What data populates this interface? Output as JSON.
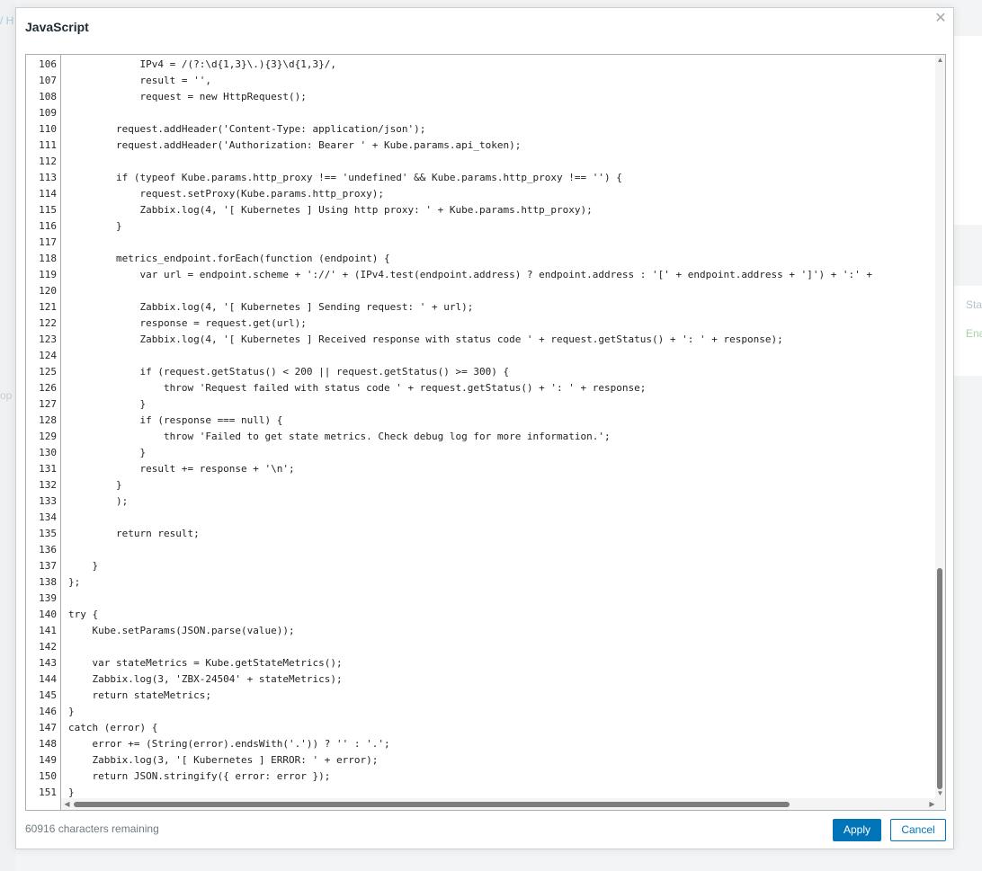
{
  "background": {
    "left_fragments": [
      "/ H",
      "op"
    ],
    "right_fragments": [
      "Sta",
      "Ena"
    ]
  },
  "modal": {
    "title": "JavaScript",
    "close_icon": "close-icon",
    "chars_remaining": "60916 characters remaining",
    "apply_label": "Apply",
    "cancel_label": "Cancel"
  },
  "editor": {
    "lines": [
      {
        "n": "106",
        "code": "            IPv4 = /(?:\\d{1,3}\\.){3}\\d{1,3}/,"
      },
      {
        "n": "107",
        "code": "            result = '',"
      },
      {
        "n": "108",
        "code": "            request = new HttpRequest();"
      },
      {
        "n": "109",
        "code": ""
      },
      {
        "n": "110",
        "code": "        request.addHeader('Content-Type: application/json');"
      },
      {
        "n": "111",
        "code": "        request.addHeader('Authorization: Bearer ' + Kube.params.api_token);"
      },
      {
        "n": "112",
        "code": ""
      },
      {
        "n": "113",
        "code": "        if (typeof Kube.params.http_proxy !== 'undefined' && Kube.params.http_proxy !== '') {"
      },
      {
        "n": "114",
        "code": "            request.setProxy(Kube.params.http_proxy);"
      },
      {
        "n": "115",
        "code": "            Zabbix.log(4, '[ Kubernetes ] Using http proxy: ' + Kube.params.http_proxy);"
      },
      {
        "n": "116",
        "code": "        }"
      },
      {
        "n": "117",
        "code": ""
      },
      {
        "n": "118",
        "code": "        metrics_endpoint.forEach(function (endpoint) {"
      },
      {
        "n": "119",
        "code": "            var url = endpoint.scheme + '://' + (IPv4.test(endpoint.address) ? endpoint.address : '[' + endpoint.address + ']') + ':' +"
      },
      {
        "n": "120",
        "code": ""
      },
      {
        "n": "121",
        "code": "            Zabbix.log(4, '[ Kubernetes ] Sending request: ' + url);"
      },
      {
        "n": "122",
        "code": "            response = request.get(url);"
      },
      {
        "n": "123",
        "code": "            Zabbix.log(4, '[ Kubernetes ] Received response with status code ' + request.getStatus() + ': ' + response);"
      },
      {
        "n": "124",
        "code": ""
      },
      {
        "n": "125",
        "code": "            if (request.getStatus() < 200 || request.getStatus() >= 300) {"
      },
      {
        "n": "126",
        "code": "                throw 'Request failed with status code ' + request.getStatus() + ': ' + response;"
      },
      {
        "n": "127",
        "code": "            }"
      },
      {
        "n": "128",
        "code": "            if (response === null) {"
      },
      {
        "n": "129",
        "code": "                throw 'Failed to get state metrics. Check debug log for more information.';"
      },
      {
        "n": "130",
        "code": "            }"
      },
      {
        "n": "131",
        "code": "            result += response + '\\n';"
      },
      {
        "n": "132",
        "code": "        }"
      },
      {
        "n": "133",
        "code": "        );"
      },
      {
        "n": "134",
        "code": ""
      },
      {
        "n": "135",
        "code": "        return result;"
      },
      {
        "n": "136",
        "code": ""
      },
      {
        "n": "137",
        "code": "    }"
      },
      {
        "n": "138",
        "code": "};"
      },
      {
        "n": "139",
        "code": ""
      },
      {
        "n": "140",
        "code": "try {"
      },
      {
        "n": "141",
        "code": "    Kube.setParams(JSON.parse(value));"
      },
      {
        "n": "142",
        "code": ""
      },
      {
        "n": "143",
        "code": "    var stateMetrics = Kube.getStateMetrics();"
      },
      {
        "n": "144",
        "code": "    Zabbix.log(3, 'ZBX-24504' + stateMetrics);"
      },
      {
        "n": "145",
        "code": "    return stateMetrics;"
      },
      {
        "n": "146",
        "code": "}"
      },
      {
        "n": "147",
        "code": "catch (error) {"
      },
      {
        "n": "148",
        "code": "    error += (String(error).endsWith('.')) ? '' : '.';"
      },
      {
        "n": "149",
        "code": "    Zabbix.log(3, '[ Kubernetes ] ERROR: ' + error);"
      },
      {
        "n": "150",
        "code": "    return JSON.stringify({ error: error });"
      },
      {
        "n": "151",
        "code": "}"
      }
    ]
  }
}
